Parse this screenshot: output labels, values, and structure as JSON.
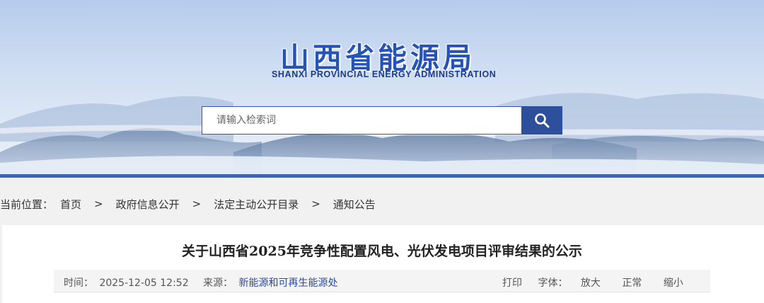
{
  "header": {
    "site_name_cn": "山西省能源局",
    "site_name_en": "SHANXI PROVINCIAL ENERGY ADMINISTRATION"
  },
  "search": {
    "placeholder": "请输入检索词",
    "button_icon": "search-icon"
  },
  "breadcrumb": {
    "prefix": "当前位置：",
    "items": [
      "首页",
      "政府信息公开",
      "法定主动公开目录",
      "通知公告"
    ],
    "separator": ">"
  },
  "article": {
    "title": "关于山西省2025年竞争性配置风电、光伏发电项目评审结果的公示",
    "time_label": "时间：",
    "time_value": "2025-12-05 12:52",
    "source_label": "来源：",
    "source_value": "新能源和可再生能源处",
    "print_label": "打印",
    "font_label": "字体：",
    "font_larger": "放大",
    "font_normal": "正常",
    "font_smaller": "缩小"
  },
  "colors": {
    "brand_blue": "#2553b6",
    "search_button": "#2e4f9b",
    "banner_line": "#3f64b4"
  }
}
